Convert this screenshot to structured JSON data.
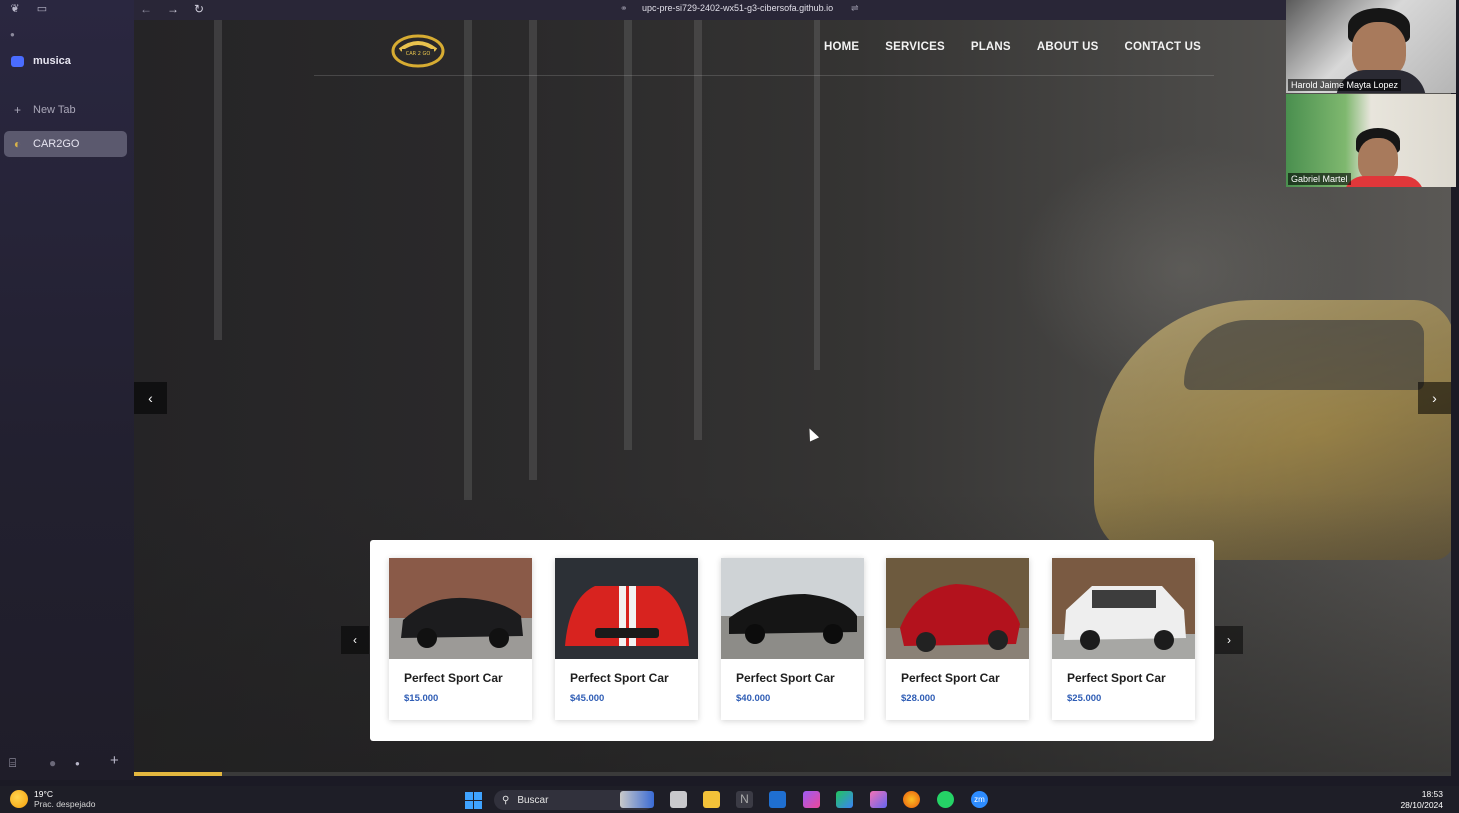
{
  "browser": {
    "url": "upc-pre-si729-2402-wx51-g3-cibersofa.github.io",
    "sidebar": {
      "space_label": "musica",
      "new_tab_label": "New Tab",
      "active_tab_label": "CAR2GO",
      "icons": [
        "sidebar-toggle-icon",
        "split-view-icon",
        "folder-icon",
        "plus-icon",
        "archive-icon"
      ]
    }
  },
  "site": {
    "logo_text": "CAR 2 GO",
    "nav": [
      "HOME",
      "SERVICES",
      "PLANS",
      "ABOUT US",
      "CONTACT US"
    ],
    "hero": {
      "prev_label": "‹",
      "next_label": "›",
      "progress": 0.067
    },
    "cars": [
      {
        "title": "Perfect Sport Car",
        "price": "$15.000",
        "color": "#1c1c1e"
      },
      {
        "title": "Perfect Sport Car",
        "price": "$45.000",
        "color": "#d8231f"
      },
      {
        "title": "Perfect Sport Car",
        "price": "$40.000",
        "color": "#151515"
      },
      {
        "title": "Perfect Sport Car",
        "price": "$28.000",
        "color": "#b3121d"
      },
      {
        "title": "Perfect Sport Car",
        "price": "$25.000",
        "color": "#eeeeee"
      }
    ]
  },
  "meeting": {
    "participants": [
      "Harold Jaime Mayta Lopez",
      "Gabriel Martel"
    ]
  },
  "taskbar": {
    "temperature": "19°C",
    "weather": "Prac. despejado",
    "search_placeholder": "Buscar",
    "time": "18:53",
    "date": "28/10/2024"
  }
}
